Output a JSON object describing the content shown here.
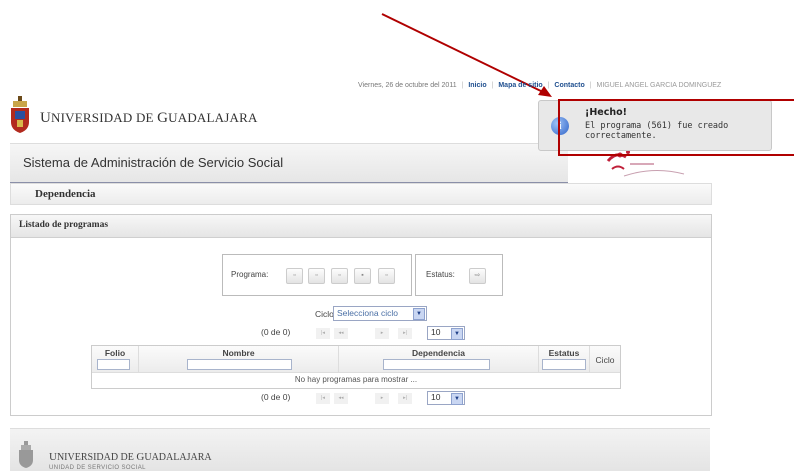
{
  "header": {
    "university_small_caps_first": "U",
    "university_rest1": "NIVERSIDAD DE ",
    "university_g": "G",
    "university_rest2": "UADALAJARA",
    "date_text": "Viernes, 26 de octubre del 2011",
    "link_inicio": "Inicio",
    "link_mapa": "Mapa de sitio",
    "link_contacto": "Contacto",
    "user_name": "MIGUEL ANGEL GARCIA DOMINGUEZ",
    "system_title": "Sistema de Administración de Servicio Social",
    "section": "Dependencia"
  },
  "panel": {
    "title": "Listado de programas",
    "programa_label": "Programa:",
    "estatus_label": "Estatus:",
    "ciclo_label": "Ciclo:",
    "ciclo_select": "Selecciona ciclo",
    "pager_top": "(0 de 0)",
    "pager_bottom": "(0 de 0)",
    "rows_per_page_top": "10",
    "rows_per_page_bottom": "10",
    "columns": [
      "Folio",
      "Nombre",
      "Dependencia",
      "Estatus",
      "Ciclo"
    ],
    "empty_message": "No hay programas para mostrar ..."
  },
  "notification": {
    "title": "¡Hecho!",
    "message": "El programa (561) fue creado correctamente.",
    "icon": "info-icon"
  },
  "footer": {
    "u": "U",
    "rest1": "NIVERSIDAD DE ",
    "g": "G",
    "rest2": "UADALAJARA",
    "sub": "UNIDAD DE SERVICIO SOCIAL"
  },
  "colors": {
    "accent": "#1f4f8f",
    "annotation": "#b00000",
    "band_line": "#8a8fa8"
  }
}
